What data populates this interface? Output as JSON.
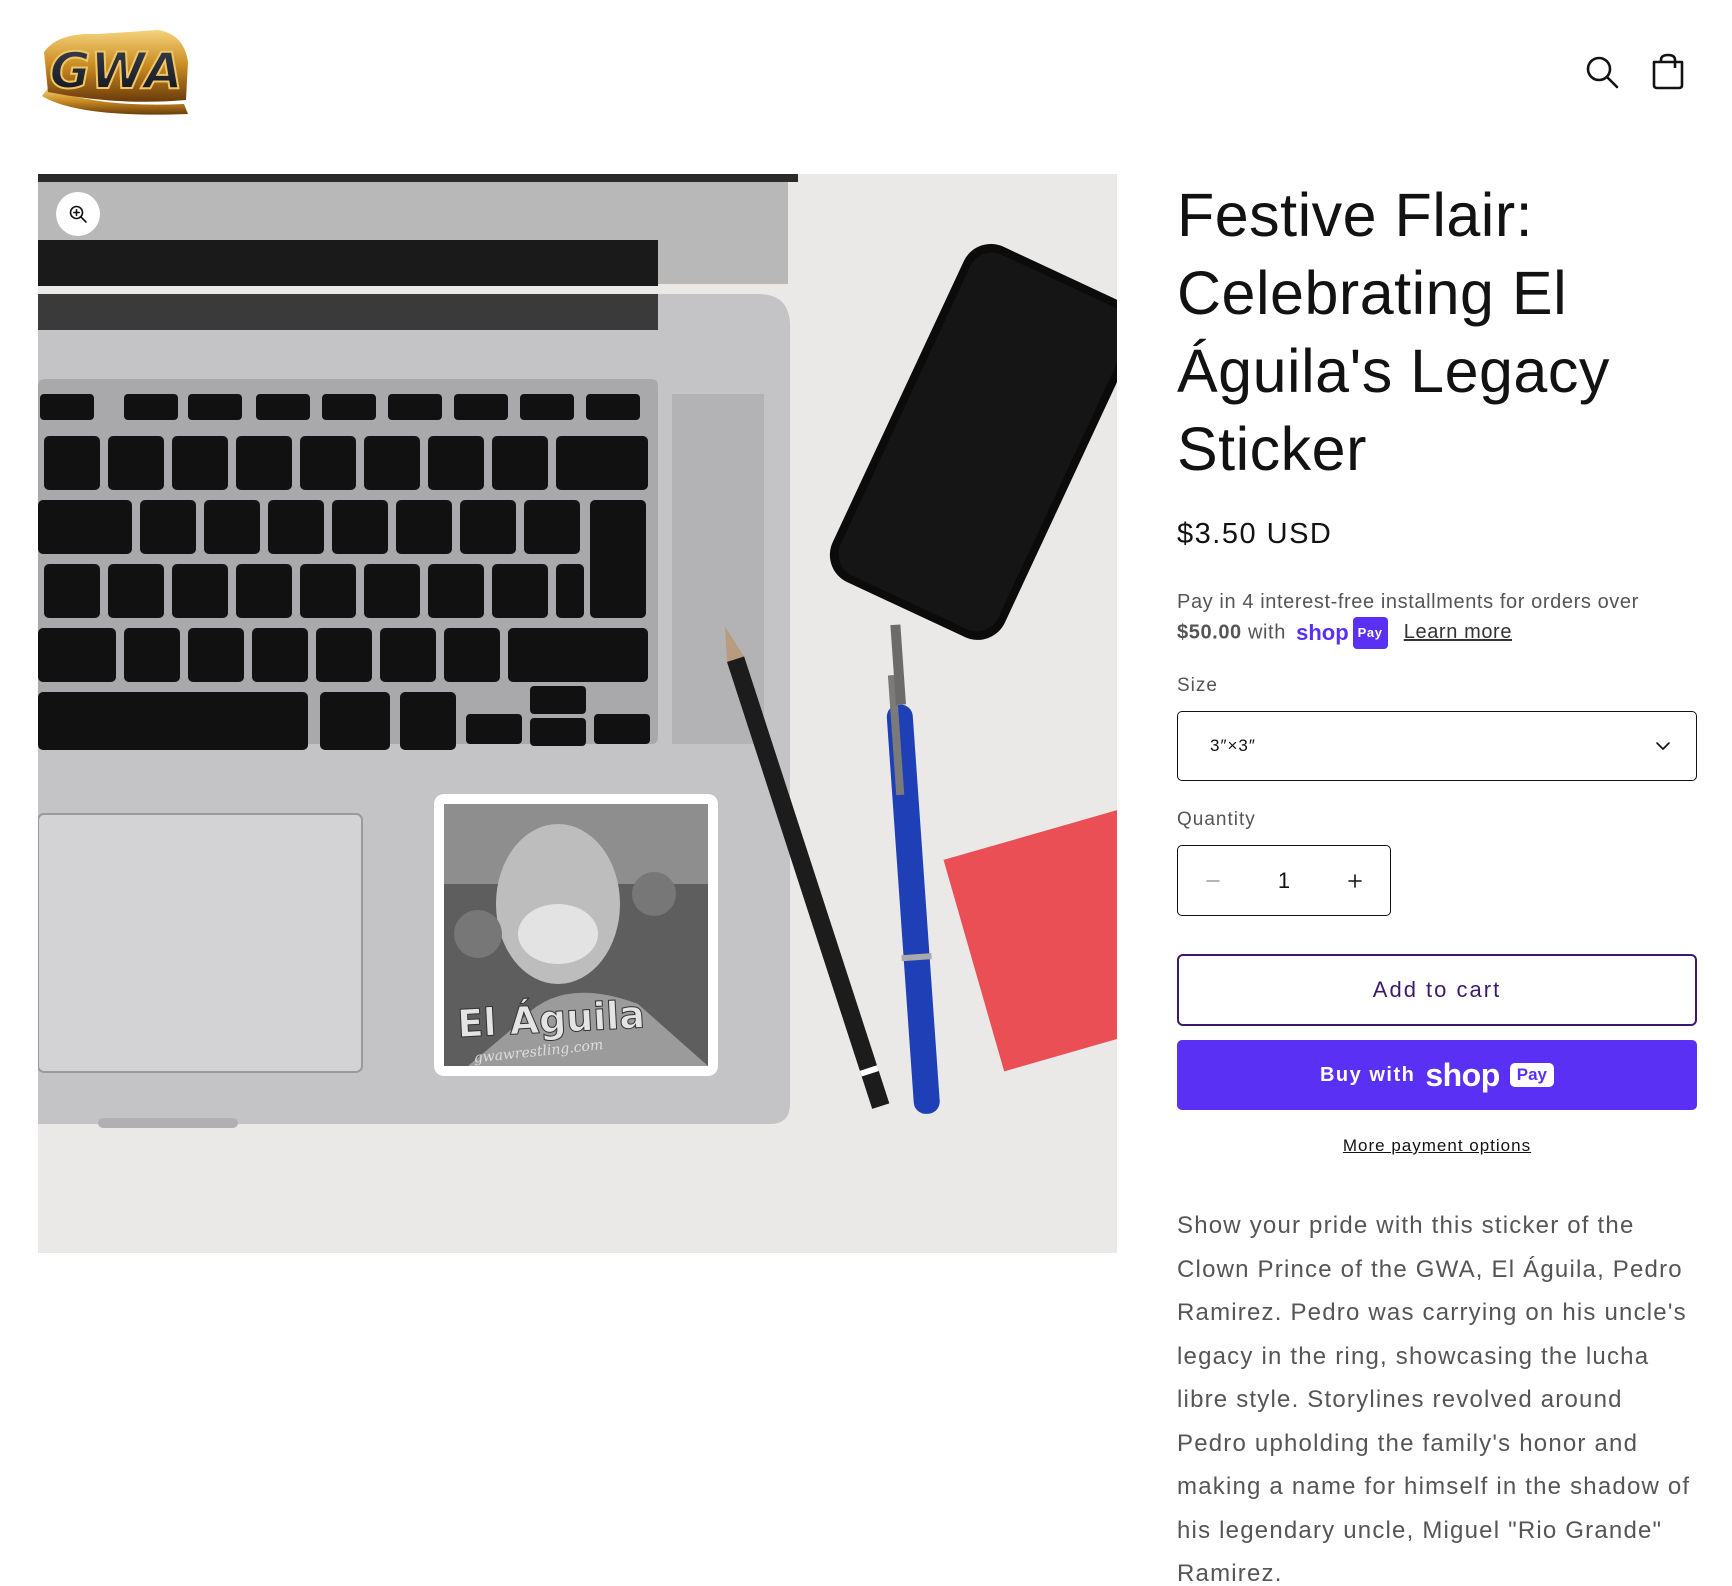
{
  "header": {
    "logo_text": "GWA",
    "icons": [
      "search-icon",
      "cart-icon"
    ]
  },
  "media": {
    "zoom_icon": "zoom-in-icon",
    "sticker_text": "El Águila",
    "sticker_url_text": "gwawrestling.com"
  },
  "product": {
    "title": "Festive Flair: Celebrating El Águila's Legacy Sticker",
    "price": "$3.50 USD",
    "installments": {
      "prefix": "Pay in 4 interest-free installments for orders over",
      "amount": "$50.00",
      "with": "with",
      "shop_word": "shop",
      "pay_pill": "Pay",
      "learn_more": "Learn more"
    },
    "size": {
      "label": "Size",
      "selected": "3″×3″"
    },
    "quantity": {
      "label": "Quantity",
      "value": "1"
    },
    "add_to_cart": "Add to cart",
    "buy_with": "Buy with",
    "buy_shop_word": "shop",
    "buy_pay_pill": "Pay",
    "more_payment_options": "More payment options",
    "description": "Show your pride with this sticker of the Clown Prince of the GWA, El Águila, Pedro Ramirez. Pedro was carrying on his uncle's legacy in the ring, showcasing the lucha libre style. Storylines revolved around Pedro upholding the family's honor and making a name for himself in the shadow of his legendary uncle, Miguel \"Rio Grande\" Ramirez."
  },
  "colors": {
    "accent_purple": "#5a31f4",
    "add_to_cart_border": "#3b1a6e",
    "text_dark": "#121212",
    "text_muted": "#555555"
  }
}
